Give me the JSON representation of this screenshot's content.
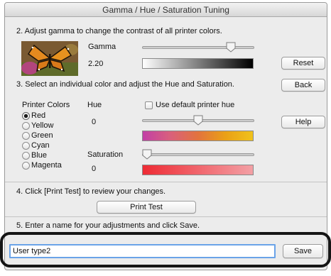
{
  "window": {
    "title": "Gamma / Hue / Saturation Tuning"
  },
  "step2": {
    "instruction": "2. Adjust gamma to change the contrast of all printer colors.",
    "gamma_label": "Gamma",
    "gamma_value": "2.20",
    "gamma_slider_level": 0.82,
    "reset_button": "Reset"
  },
  "step3": {
    "instruction": "3. Select an individual color and adjust the Hue and Saturation.",
    "back_button": "Back",
    "help_button": "Help",
    "printer_colors_label": "Printer Colors",
    "colors": [
      {
        "label": "Red",
        "selected": true
      },
      {
        "label": "Yellow",
        "selected": false
      },
      {
        "label": "Green",
        "selected": false
      },
      {
        "label": "Cyan",
        "selected": false
      },
      {
        "label": "Blue",
        "selected": false
      },
      {
        "label": "Magenta",
        "selected": false
      }
    ],
    "hue_label": "Hue",
    "hue_value": "0",
    "hue_slider_level": 0.5,
    "use_default_hue_label": "Use default printer hue",
    "use_default_hue_checked": false,
    "saturation_label": "Saturation",
    "saturation_value": "0",
    "saturation_slider_level": 0.0
  },
  "step4": {
    "instruction": "4. Click [Print Test] to review your changes.",
    "print_test_button": "Print Test"
  },
  "step5": {
    "instruction": "5. Enter a name for your adjustments and click Save.",
    "name_value": "User type2",
    "save_button": "Save"
  },
  "colors": {
    "hue_gradient": [
      "#c23fa6",
      "#d9607c",
      "#e2733e",
      "#eaa016",
      "#f0c21b"
    ],
    "saturation_gradient": [
      "#ee2b34",
      "#f3a0a5"
    ],
    "focus_border": "#6aa3e8",
    "highlight_ring": "#151515"
  },
  "icons": {
    "sample_image": "butterfly-photo-icon",
    "slider_thumb": "slider-thumb-icon"
  }
}
